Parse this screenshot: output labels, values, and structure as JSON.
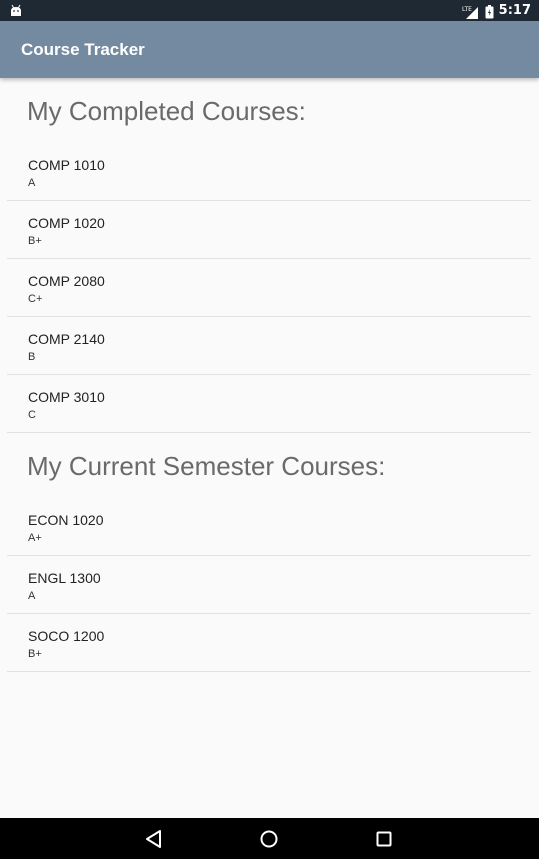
{
  "status_bar": {
    "time": "5:17",
    "network_label": "LTE",
    "icons": [
      "android-icon",
      "lte-signal-icon",
      "battery-icon"
    ]
  },
  "app_bar": {
    "title": "Course Tracker",
    "color": "#738aa0"
  },
  "completed": {
    "heading": "My Completed Courses:",
    "courses": [
      {
        "name": "COMP 1010",
        "grade": "A"
      },
      {
        "name": "COMP 1020",
        "grade": "B+"
      },
      {
        "name": "COMP 2080",
        "grade": "C+"
      },
      {
        "name": "COMP 2140",
        "grade": "B"
      },
      {
        "name": "COMP 3010",
        "grade": "C"
      }
    ]
  },
  "current": {
    "heading": "My Current Semester Courses:",
    "courses": [
      {
        "name": "ECON 1020",
        "grade": "A+"
      },
      {
        "name": "ENGL 1300",
        "grade": "A"
      },
      {
        "name": "SOCO 1200",
        "grade": "B+"
      }
    ]
  },
  "nav_bar": {
    "icons": [
      "back-icon",
      "home-icon",
      "recents-icon"
    ]
  }
}
